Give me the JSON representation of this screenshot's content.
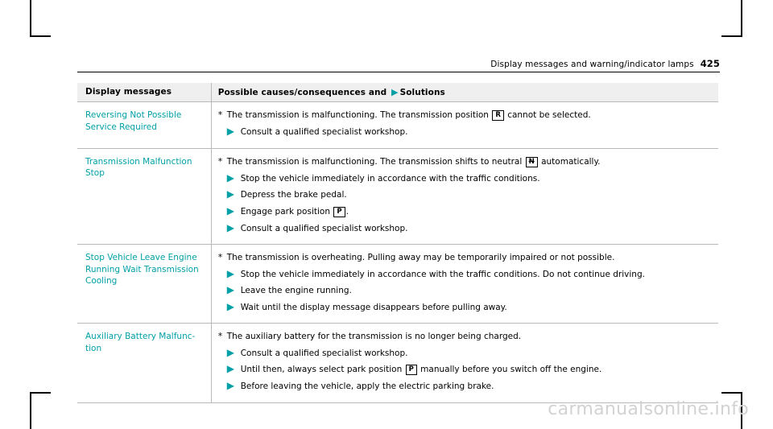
{
  "header": {
    "title": "Display messages and warning/indicator lamps",
    "page_number": "425"
  },
  "table": {
    "columns": [
      {
        "label": "Display messages"
      },
      {
        "label_before_arrow": "Possible causes/consequences and ",
        "arrow": "▶",
        "label_after_arrow": "Solutions"
      }
    ],
    "rows": [
      {
        "message": "Reversing Not Possible Service Required",
        "cause": {
          "marker": "*",
          "text_before": "The transmission is malfunctioning. The transmission position ",
          "glyph": "R",
          "glyph_strike": false,
          "text_after": " cannot be selected."
        },
        "solutions": [
          {
            "text_before": "Consult a qualified specialist workshop.",
            "glyph": "",
            "text_after": ""
          }
        ]
      },
      {
        "message": "Transmission Malfunction Stop",
        "cause": {
          "marker": "*",
          "text_before": "The transmission is malfunctioning. The transmission shifts to neutral ",
          "glyph": "N",
          "glyph_strike": true,
          "text_after": " automatically."
        },
        "solutions": [
          {
            "text_before": "Stop the vehicle immediately in accordance with the traffic conditions.",
            "glyph": "",
            "text_after": ""
          },
          {
            "text_before": "Depress the brake pedal.",
            "glyph": "",
            "text_after": ""
          },
          {
            "text_before": "Engage park position ",
            "glyph": "P",
            "text_after": "."
          },
          {
            "text_before": "Consult a qualified specialist workshop.",
            "glyph": "",
            "text_after": ""
          }
        ]
      },
      {
        "message": "Stop Vehicle Leave Engine Running Wait Transmission Cooling",
        "cause": {
          "marker": "*",
          "text_before": "The transmission is overheating. Pulling away may be temporarily impaired or not possible.",
          "glyph": "",
          "glyph_strike": false,
          "text_after": ""
        },
        "solutions": [
          {
            "text_before": "Stop the vehicle immediately in accordance with the traffic conditions. Do not continue driving.",
            "glyph": "",
            "text_after": ""
          },
          {
            "text_before": "Leave the engine running.",
            "glyph": "",
            "text_after": ""
          },
          {
            "text_before": "Wait until the display message disappears before pulling away.",
            "glyph": "",
            "text_after": ""
          }
        ]
      },
      {
        "message": "Auxiliary Battery Malfunc- tion",
        "cause": {
          "marker": "*",
          "text_before": "The auxiliary battery for the transmission is no longer being charged.",
          "glyph": "",
          "glyph_strike": false,
          "text_after": ""
        },
        "solutions": [
          {
            "text_before": "Consult a qualified specialist workshop.",
            "glyph": "",
            "text_after": ""
          },
          {
            "text_before": "Until then, always select park position ",
            "glyph": "P",
            "text_after": " manually before you switch off the engine."
          },
          {
            "text_before": "Before leaving the vehicle, apply the electric parking brake.",
            "glyph": "",
            "text_after": ""
          }
        ]
      }
    ]
  },
  "watermark": "carmanualsonline.info",
  "colors": {
    "accent": "#00a0a6",
    "header_fill": "#efefef",
    "rule": "#b9b9b9",
    "watermark": "#d2d2d2"
  }
}
